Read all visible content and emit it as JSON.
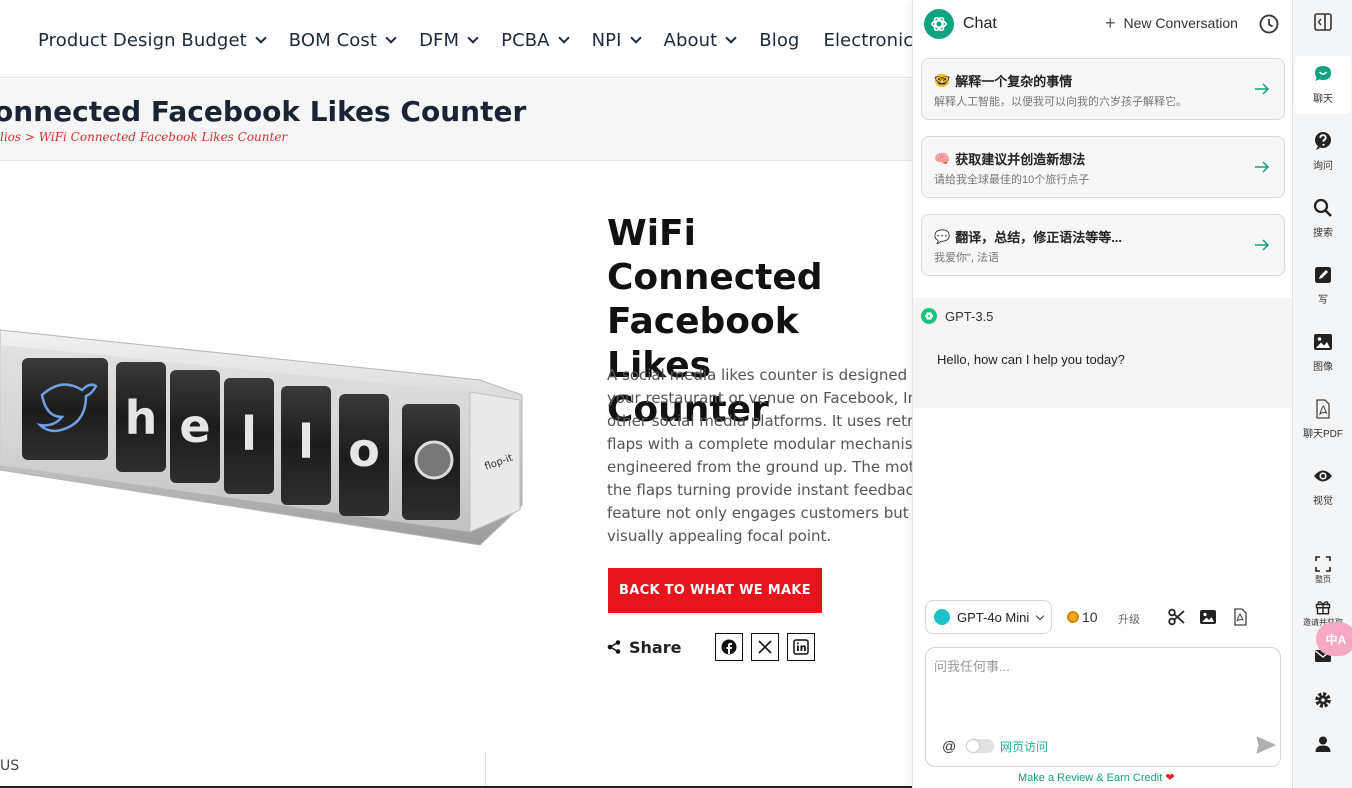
{
  "nav": {
    "items": [
      {
        "label": "Product Design Budget",
        "has_caret": true
      },
      {
        "label": "BOM Cost",
        "has_caret": true
      },
      {
        "label": "DFM",
        "has_caret": true
      },
      {
        "label": "PCBA",
        "has_caret": true
      },
      {
        "label": "NPI",
        "has_caret": true
      },
      {
        "label": "About",
        "has_caret": true
      },
      {
        "label": "Blog",
        "has_caret": false
      },
      {
        "label": "Electronics Ne",
        "has_caret": false
      }
    ]
  },
  "banner": {
    "title": "onnected Facebook Likes Counter",
    "breadcrumb": "lios > WiFi Connected Facebook Likes Counter"
  },
  "product": {
    "image_letters": [
      "h",
      "e",
      "l",
      "l",
      "o"
    ],
    "image_brand": "flop-it",
    "title_lines": [
      "WiFi Connected",
      "Facebook Likes",
      "Counter"
    ],
    "description_lines": [
      "A social media likes counter is designed to a",
      "your restaurant or venue on Facebook, Insta",
      "other social media platforms. It uses retro-a",
      "flaps with a complete modular mechanism c",
      "engineered from the ground up. The motion",
      "the flaps turning provide instant feedback. T",
      "feature not only engages customers but also",
      "visually appealing focal point."
    ],
    "cta_label": "BACK TO WHAT WE MAKE",
    "share_label": "Share"
  },
  "footer": {
    "fragment": "US"
  },
  "chat": {
    "title": "Chat",
    "new_conversation": "New Conversation",
    "prompts": [
      {
        "emoji": "🤓",
        "title": "解释一个复杂的事情",
        "subtitle": "解释人工智能，以便我可以向我的六岁孩子解释它。"
      },
      {
        "emoji": "🧠",
        "title": "获取建议并创造新想法",
        "subtitle": "请给我全球最佳的10个旅行点子"
      },
      {
        "emoji": "💬",
        "title": "翻译，总结，修正语法等等...",
        "subtitle": "我爱你\", 法语"
      }
    ],
    "message": {
      "model": "GPT-3.5",
      "text": "Hello, how can I help you today?"
    },
    "toolbar": {
      "model_selected": "GPT-4o Mini",
      "credits": "10",
      "upgrade": "升级"
    },
    "input": {
      "placeholder": "问我任何事...",
      "at": "@",
      "web_access": "网页访问"
    },
    "review": "Make a Review & Earn Credit"
  },
  "rail": {
    "items": [
      {
        "label": "聊天",
        "icon": "chat-bubble-icon"
      },
      {
        "label": "询问",
        "icon": "question-icon"
      },
      {
        "label": "搜索",
        "icon": "search-icon"
      },
      {
        "label": "写",
        "icon": "pencil-icon"
      },
      {
        "label": "图像",
        "icon": "image-icon"
      },
      {
        "label": "聊天PDF",
        "icon": "pdf-icon"
      },
      {
        "label": "视觉",
        "icon": "eye-icon"
      }
    ],
    "small": [
      {
        "label": "整页",
        "icon": "fullscreen-icon"
      },
      {
        "label": "邀请并获取",
        "icon": "gift-icon"
      }
    ],
    "translate_glyph": "中A"
  },
  "colors": {
    "accent_green": "#10a37f",
    "cta_red": "#e8141c",
    "breadcrumb_red": "#d63030"
  }
}
